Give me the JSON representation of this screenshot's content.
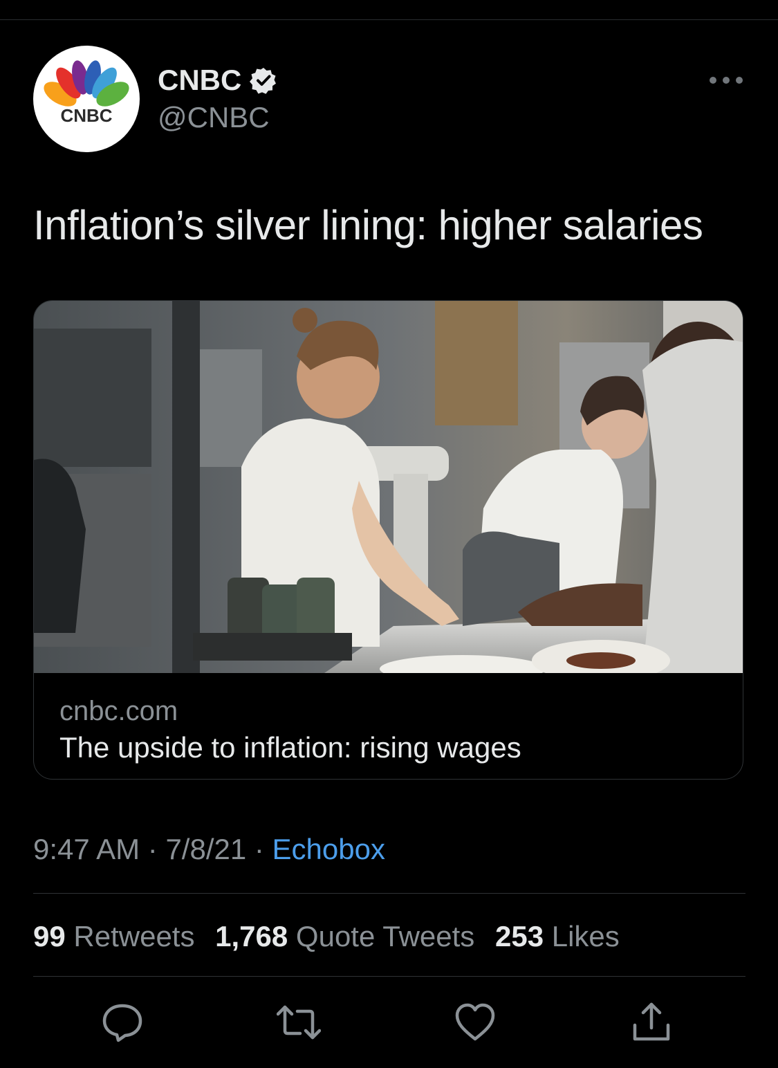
{
  "tweet": {
    "display_name": "CNBC",
    "handle": "@CNBC",
    "verified_icon": "verified-badge-icon",
    "more_icon": "more-dots-icon",
    "avatar_logo_text": "CNBC",
    "text": "Inflation’s silver lining: higher salaries",
    "card": {
      "domain": "cnbc.com",
      "title": "The upside to inflation: rising wages"
    },
    "time": "9:47 AM",
    "date": "7/8/21",
    "source": "Echobox",
    "separator": " · ",
    "stats": {
      "retweets_count": "99",
      "retweets_label": "Retweets",
      "quotes_count": "1,768",
      "quotes_label": "Quote Tweets",
      "likes_count": "253",
      "likes_label": "Likes"
    },
    "actions": [
      "reply-icon",
      "retweet-icon",
      "like-icon",
      "share-icon"
    ]
  },
  "colors": {
    "background": "#000000",
    "link": "#4c9eeb",
    "secondary_text": "#8b9196",
    "primary_text": "#e7e9ea",
    "divider": "#2f3336"
  }
}
